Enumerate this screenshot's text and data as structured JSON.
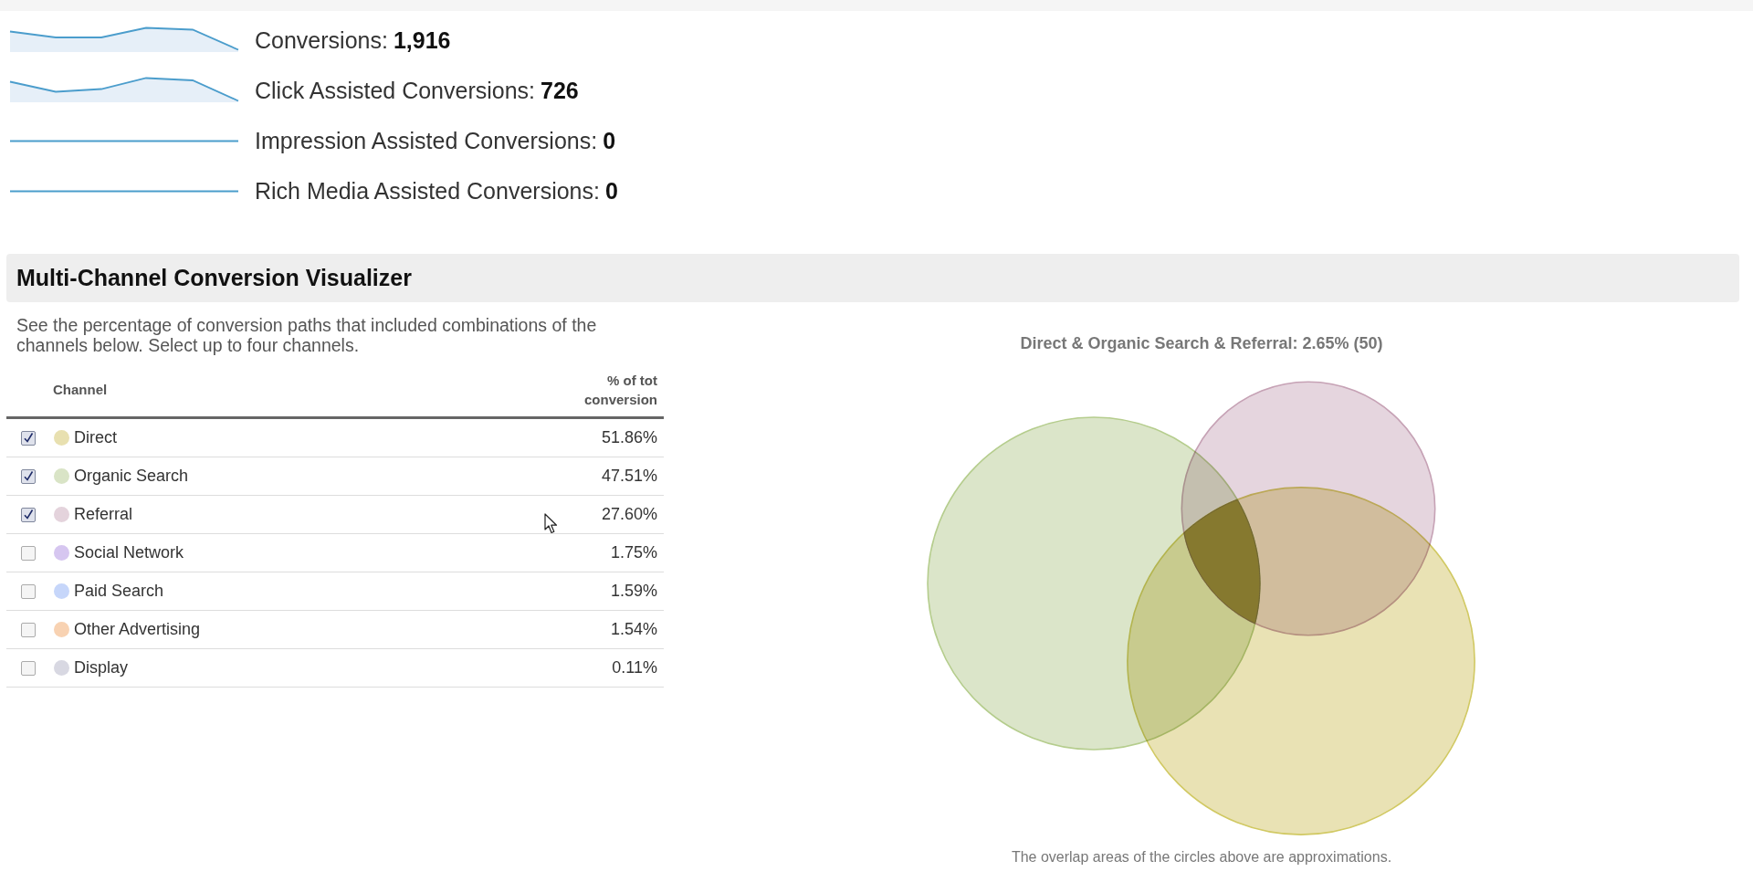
{
  "metrics": [
    {
      "label": "Conversions:",
      "value": "1,916"
    },
    {
      "label": "Click Assisted Conversions:",
      "value": "726"
    },
    {
      "label": "Impression Assisted Conversions:",
      "value": "0"
    },
    {
      "label": "Rich Media Assisted Conversions:",
      "value": "0"
    }
  ],
  "visualizer": {
    "title": "Multi-Channel Conversion Visualizer",
    "description": "See the percentage of conversion paths that included combinations of the channels below. Select up to four channels.",
    "table": {
      "columns": [
        "Channel",
        "% of tot conversion"
      ],
      "rows": [
        {
          "channel": "Direct",
          "color": "#e8e0b0",
          "checked": true,
          "value": "51.86%"
        },
        {
          "channel": "Organic Search",
          "color": "#d9e4c6",
          "checked": true,
          "value": "47.51%"
        },
        {
          "channel": "Referral",
          "color": "#e4d3dc",
          "checked": true,
          "value": "27.60%"
        },
        {
          "channel": "Social Network",
          "color": "#d6c6f0",
          "checked": false,
          "value": "1.75%"
        },
        {
          "channel": "Paid Search",
          "color": "#c6d6fa",
          "checked": false,
          "value": "1.59%"
        },
        {
          "channel": "Other Advertising",
          "color": "#f8d2b2",
          "checked": false,
          "value": "1.54%"
        },
        {
          "channel": "Display",
          "color": "#d8d8e2",
          "checked": false,
          "value": "0.11%"
        }
      ]
    },
    "venn": {
      "title": "Direct & Organic Search & Referral: 2.65% (50)",
      "caption": "The overlap areas of the circles above are approximations."
    }
  }
}
